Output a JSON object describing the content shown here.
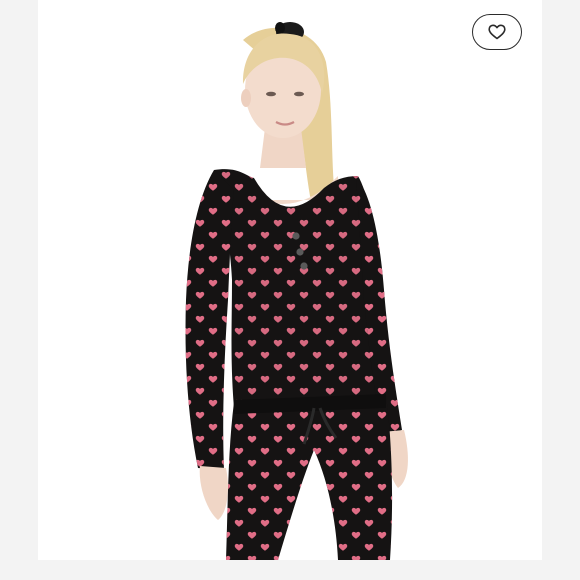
{
  "listing": {
    "image_subject": "model-wearing-black-heart-print-henley-pajama-set",
    "like_button_icon": "heart-outline-icon"
  },
  "colors": {
    "page_background": "#f3f3f3",
    "photo_background": "#ffffff",
    "garment": "#151313",
    "heart_print": "#e06d86",
    "button_border": "#2b2b2b"
  }
}
